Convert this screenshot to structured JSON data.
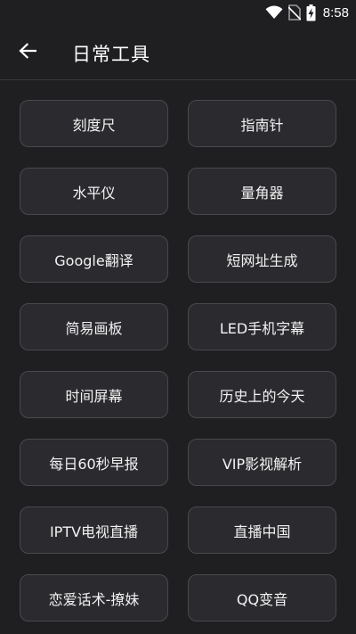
{
  "status_bar": {
    "time": "8:58",
    "icons": [
      "wifi-icon",
      "no-sim-icon",
      "battery-charging-icon"
    ]
  },
  "app_bar": {
    "back_icon": "arrow-back-icon",
    "title": "日常工具"
  },
  "tools": [
    {
      "label": "刻度尺"
    },
    {
      "label": "指南针"
    },
    {
      "label": "水平仪"
    },
    {
      "label": "量角器"
    },
    {
      "label": "Google翻译"
    },
    {
      "label": "短网址生成"
    },
    {
      "label": "简易画板"
    },
    {
      "label": "LED手机字幕"
    },
    {
      "label": "时间屏幕"
    },
    {
      "label": "历史上的今天"
    },
    {
      "label": "每日60秒早报"
    },
    {
      "label": "VIP影视解析"
    },
    {
      "label": "IPTV电视直播"
    },
    {
      "label": "直播中国"
    },
    {
      "label": "恋爱话术-撩妹"
    },
    {
      "label": "QQ变音"
    }
  ],
  "colors": {
    "background": "#1f1f22",
    "button_background": "#2b2b2f",
    "button_border": "#48484d",
    "text": "#ffffff"
  }
}
